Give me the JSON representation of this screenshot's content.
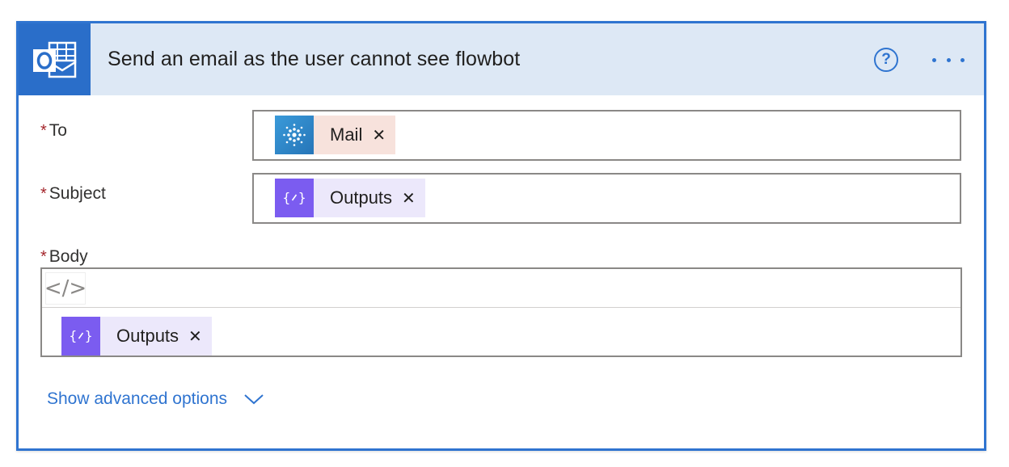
{
  "action": {
    "title": "Send an email as the user cannot see flowbot",
    "app_icon": "outlook-icon",
    "help_icon": "question-circle-icon",
    "more_icon": "ellipsis-icon",
    "help_label": "?"
  },
  "fields": {
    "to": {
      "required_mark": "*",
      "label": "To",
      "tokens": [
        {
          "text": "Mail",
          "icon": "dynamic-content-icon",
          "close": "✕"
        }
      ]
    },
    "subject": {
      "required_mark": "*",
      "label": "Subject",
      "tokens": [
        {
          "text": "Outputs",
          "icon": "expression-icon",
          "close": "✕"
        }
      ]
    },
    "body": {
      "required_mark": "*",
      "label": "Body",
      "code_view_label": "</>",
      "tokens": [
        {
          "text": "Outputs",
          "icon": "expression-icon",
          "close": "✕"
        }
      ]
    }
  },
  "advanced": {
    "label": "Show advanced options",
    "icon": "chevron-down-icon"
  },
  "colors": {
    "accent": "#2f74d0",
    "header_bg": "#dde8f5",
    "required": "#a4262c",
    "mail_token_bg": "#f7e2dc",
    "expression_token_bg": "#ece8fb",
    "expression_icon_bg": "#7b5cf0"
  }
}
